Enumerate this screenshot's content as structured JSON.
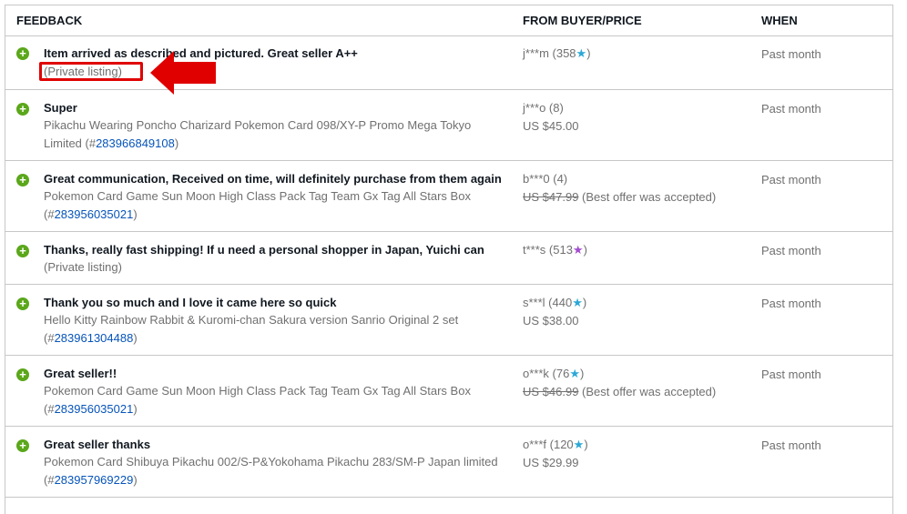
{
  "header": {
    "feedback": "FEEDBACK",
    "from": "FROM BUYER/PRICE",
    "when": "WHEN"
  },
  "annotation": {
    "marker_color": "#e00000"
  },
  "rows": [
    {
      "comment": "Item arrived as described and pictured. Great seller A++",
      "item_text": "(Private listing)",
      "item_id": "",
      "buyer": "j***m (358",
      "star": "★",
      "buyer_close": ")",
      "price": "",
      "when": "Past month"
    },
    {
      "comment": "Super",
      "item_text": "Pikachu Wearing Poncho Charizard Pokemon Card 098/XY-P Promo Mega Tokyo Limited (#",
      "item_id": "283966849108",
      "buyer": "j***o (8)",
      "price": "US $45.00",
      "when": "Past month"
    },
    {
      "comment": "Great communication, Received on time, will definitely purchase from them again",
      "item_text": "Pokemon Card Game Sun Moon High Class Pack Tag Team Gx Tag All Stars Box (#",
      "item_id": "283956035021",
      "buyer": "b***0 (4)",
      "price_strike": "US $47.99",
      "price_note": " (Best offer was accepted)",
      "when": "Past month"
    },
    {
      "comment": "Thanks, really fast shipping! If u need a personal shopper in Japan, Yuichi can",
      "item_text": "(Private listing)",
      "item_id": "",
      "buyer": "t***s (513",
      "star": "★",
      "buyer_close": ")",
      "when": "Past month"
    },
    {
      "comment": "Thank you so much and I love it came here so quick",
      "item_text": "Hello Kitty Rainbow Rabbit & Kuromi-chan Sakura version Sanrio Original 2 set (#",
      "item_id": "283961304488",
      "buyer": "s***l (440",
      "star": "★",
      "buyer_close": ")",
      "price": "US $38.00",
      "when": "Past month"
    },
    {
      "comment": "Great seller!!",
      "item_text": "Pokemon Card Game Sun Moon High Class Pack Tag Team Gx Tag All Stars Box (#",
      "item_id": "283956035021",
      "buyer": "o***k (76",
      "star": "★",
      "buyer_close": ")",
      "price_strike": "US $46.99",
      "price_note": " (Best offer was accepted)",
      "when": "Past month"
    },
    {
      "comment": "Great seller thanks",
      "item_text": "Pokemon Card Shibuya Pikachu 002/S-P&Yokohama Pikachu 283/SM-P Japan limited (#",
      "item_id": "283957969229",
      "buyer": "o***f (120",
      "star": "★",
      "buyer_close": ")",
      "price": "US $29.99",
      "when": "Past month"
    }
  ],
  "close_paren": ")",
  "plus": "+",
  "colors": {
    "positive": "#5ba71b",
    "link": "#0654ba",
    "star_teal": "#2ca8d6",
    "star_purple": "#a24ccf"
  }
}
